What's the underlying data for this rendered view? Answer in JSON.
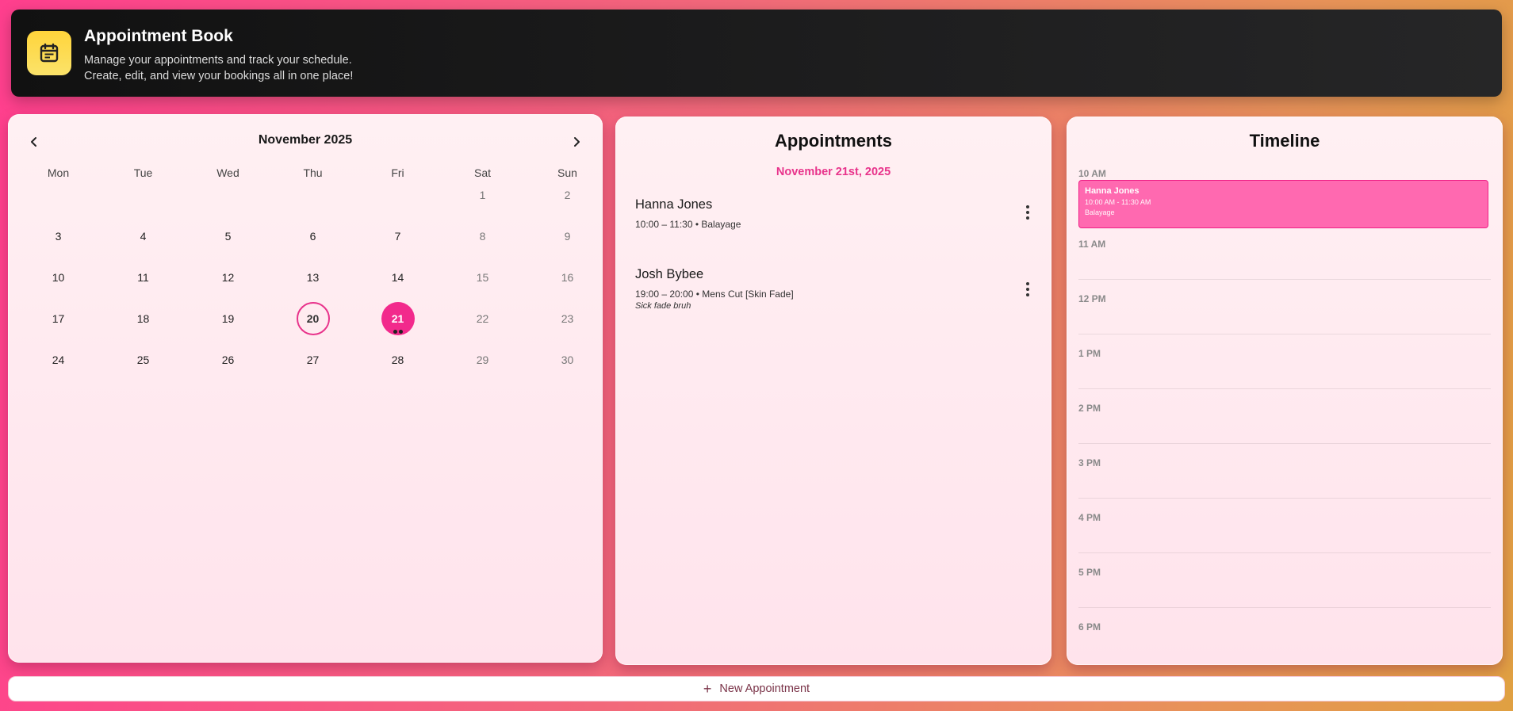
{
  "header": {
    "title": "Appointment Book",
    "subtitle_line1": "Manage your appointments and track your schedule.",
    "subtitle_line2": "Create, edit, and view your bookings all in one place!",
    "logo_icon": "calendar-note-icon",
    "logo_color": "#ffd43b"
  },
  "calendar": {
    "month_label": "November 2025",
    "prev_icon": "chevron-left-icon",
    "next_icon": "chevron-right-icon",
    "weekdays": [
      "Mon",
      "Tue",
      "Wed",
      "Thu",
      "Fri",
      "Sat",
      "Sun"
    ],
    "days": [
      "1",
      "2",
      "3",
      "4",
      "5",
      "6",
      "7",
      "8",
      "9",
      "10",
      "11",
      "12",
      "13",
      "14",
      "15",
      "16",
      "17",
      "18",
      "19",
      "20",
      "21",
      "22",
      "23",
      "24",
      "25",
      "26",
      "27",
      "28",
      "29",
      "30"
    ],
    "today": "20",
    "selected": "21",
    "days_with_appointments": [
      "21"
    ],
    "accent_color": "#f22a8c"
  },
  "appointments": {
    "title": "Appointments",
    "date_label": "November 21st, 2025",
    "items": [
      {
        "name": "Hanna Jones",
        "meta": "10:00 – 11:30 • Balayage",
        "note": ""
      },
      {
        "name": "Josh Bybee",
        "meta": "19:00 – 20:00 • Mens Cut [Skin Fade]",
        "note": "Sick fade bruh"
      }
    ]
  },
  "timeline": {
    "title": "Timeline",
    "hours": [
      "10 AM",
      "11 AM",
      "12 PM",
      "1 PM",
      "2 PM",
      "3 PM",
      "4 PM",
      "5 PM",
      "6 PM"
    ],
    "events": [
      {
        "name": "Hanna Jones",
        "time": "10:00 AM - 11:30 AM",
        "service": "Balayage"
      }
    ],
    "event_color": "#ff69b0"
  },
  "actions": {
    "new_appointment_label": "New Appointment",
    "new_icon": "plus-icon"
  }
}
